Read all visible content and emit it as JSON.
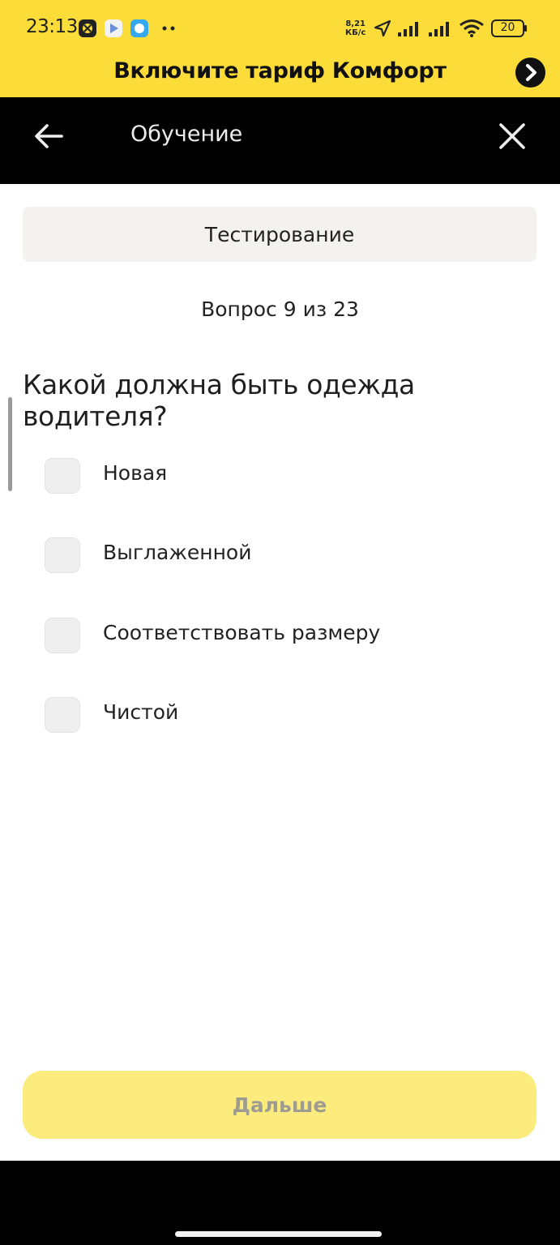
{
  "status_bar": {
    "time": "23:13",
    "net_speed_value": "8,21",
    "net_speed_unit": "КБ/с",
    "battery": "20",
    "icons": [
      "notification-app-icon",
      "play-store-icon",
      "app-icon",
      "more-dots-icon",
      "location-arrow-icon",
      "signal-icon",
      "signal-icon",
      "wifi-icon",
      "battery-icon"
    ]
  },
  "promo": {
    "text": "Включите тариф Комфорт",
    "arrow_icon": "chevron-right-icon"
  },
  "header": {
    "back_icon": "arrow-left-icon",
    "title": "Обучение",
    "close_icon": "close-icon"
  },
  "section": {
    "label": "Тестирование"
  },
  "progress": {
    "text": "Вопрос 9 из 23"
  },
  "question": {
    "text": "Какой должна быть одежда водителя?",
    "options": [
      {
        "label": "Новая",
        "checked": false
      },
      {
        "label": "Выглаженной",
        "checked": false
      },
      {
        "label": "Соответствовать размеру",
        "checked": false
      },
      {
        "label": "Чистой",
        "checked": false
      }
    ]
  },
  "next_button": {
    "label": "Дальше",
    "enabled": false
  },
  "colors": {
    "brand_yellow": "#fbdc38",
    "button_disabled": "#fcec7e",
    "header_bg": "#000000"
  }
}
